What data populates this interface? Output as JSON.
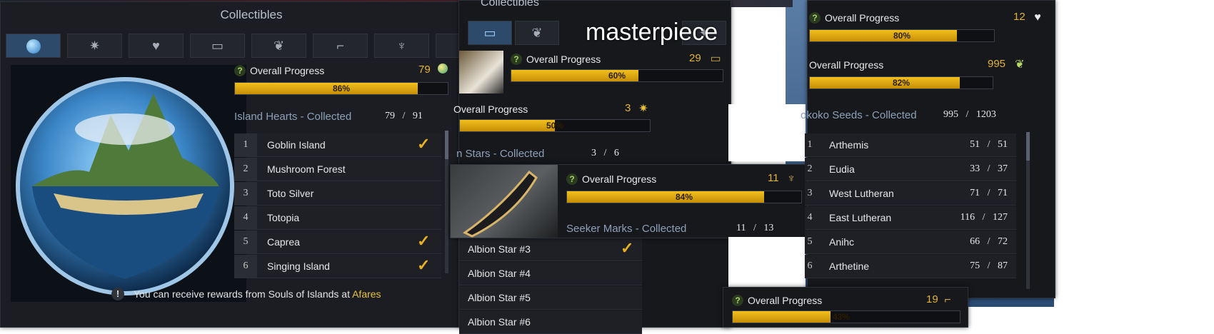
{
  "panel_main": {
    "title": "Collectibles",
    "close_glyph": "✕",
    "tabs": [
      {
        "icon": "globe-icon",
        "glyph": "●",
        "active": true
      },
      {
        "icon": "star-compass-icon",
        "glyph": "✷",
        "active": false
      },
      {
        "icon": "heart-icon",
        "glyph": "♥",
        "active": false
      },
      {
        "icon": "card-icon",
        "glyph": "▭",
        "active": false
      },
      {
        "icon": "seed-icon",
        "glyph": "❦",
        "active": false
      },
      {
        "icon": "telescope-icon",
        "glyph": "⌐",
        "active": false
      },
      {
        "icon": "mask-icon",
        "glyph": "♆",
        "active": false
      },
      {
        "icon": "leaf-icon",
        "glyph": "✦",
        "active": false
      }
    ],
    "progress": {
      "label": "Overall Progress",
      "count": "79",
      "percent": "86%",
      "fraction": 0.86,
      "icon": "globe-icon"
    },
    "section_title": "Island Hearts - Collected",
    "section_count": "79   /   91",
    "items": [
      {
        "num": "1",
        "name": "Goblin Island",
        "checked": true
      },
      {
        "num": "2",
        "name": "Mushroom Forest",
        "checked": false
      },
      {
        "num": "3",
        "name": "Toto Silver",
        "checked": false
      },
      {
        "num": "4",
        "name": "Totopia",
        "checked": false
      },
      {
        "num": "5",
        "name": "Caprea",
        "checked": true
      },
      {
        "num": "6",
        "name": "Singing Island",
        "checked": true
      }
    ],
    "footer_text": "You can receive rewards from Souls of Islands at ",
    "footer_link": "Afares",
    "footer_icon": "alert-icon"
  },
  "panel_mid": {
    "title": "Collectibles",
    "watermark": "masterpiece",
    "progress_card": {
      "label": "Overall Progress",
      "count": "29",
      "percent": "60%",
      "fraction": 0.6,
      "icon": "card-icon"
    },
    "progress_star": {
      "label": "Overall Progress",
      "count": "3",
      "percent": "50%",
      "fraction": 0.5,
      "icon": "star-icon"
    },
    "section_partial": "n Stars - Collected",
    "section_partial_count": "3   /   6",
    "progress_seeker": {
      "label": "Overall Progress",
      "count": "11",
      "percent": "84%",
      "fraction": 0.84,
      "icon": "mask-icon"
    },
    "seeker_title": "Seeker Marks - Collected",
    "seeker_count": "11   /   13",
    "albion": [
      {
        "name": "Albion Star #3",
        "checked": true
      },
      {
        "name": "Albion Star #4",
        "checked": false
      },
      {
        "name": "Albion Star #5",
        "checked": false
      },
      {
        "name": "Albion Star #6",
        "checked": false
      }
    ]
  },
  "panel_right": {
    "progress_hearts": {
      "label": "Overall Progress",
      "count": "12",
      "percent": "80%",
      "fraction": 0.8,
      "icon": "heart-icon"
    },
    "progress_seeds": {
      "label": "Overall Progress",
      "count": "995",
      "percent": "82%",
      "fraction": 0.82,
      "icon": "seed-icon"
    },
    "section_title": "okoko Seeds - Collected",
    "section_count": "995   /   1203",
    "regions": [
      {
        "num": "1",
        "name": "Arthemis",
        "stat": "51   /   51"
      },
      {
        "num": "2",
        "name": "Eudia",
        "stat": "33   /   37"
      },
      {
        "num": "3",
        "name": "West Lutheran",
        "stat": "71   /   71"
      },
      {
        "num": "4",
        "name": "East Lutheran",
        "stat": "116   /   127"
      },
      {
        "num": "5",
        "name": "Anihc",
        "stat": "66   /   72"
      },
      {
        "num": "6",
        "name": "Arthetine",
        "stat": "75   /   87"
      }
    ],
    "progress_telescope": {
      "label": "Overall Progress",
      "count": "19",
      "percent": "43%",
      "fraction": 0.43,
      "icon": "telescope-icon"
    }
  }
}
